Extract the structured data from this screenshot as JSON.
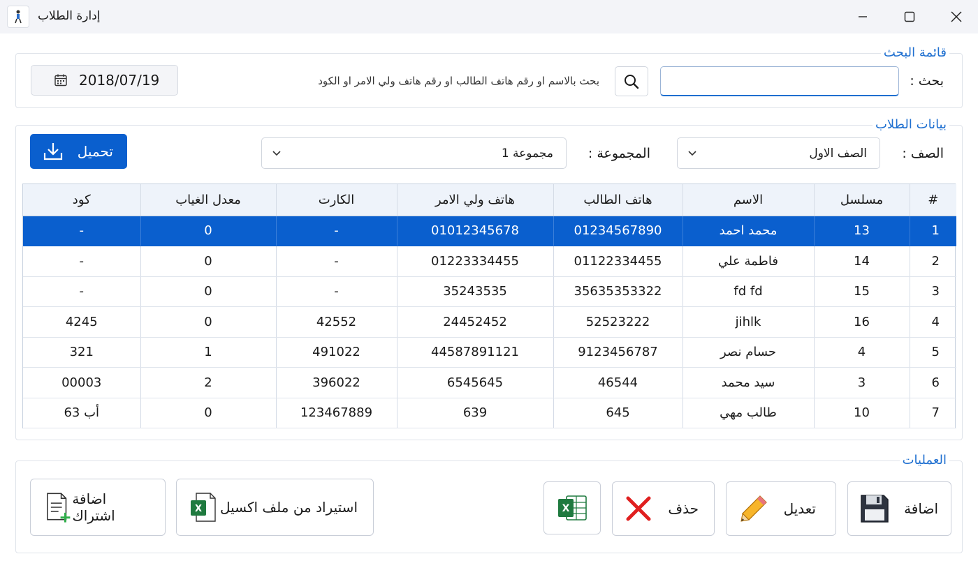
{
  "window": {
    "title": "إدارة الطلاب",
    "controls": [
      "minimize",
      "maximize",
      "close"
    ]
  },
  "search_group": {
    "legend": "قائمة البحث",
    "label": "بحث  :",
    "input_value": "",
    "hint": "بحث بالاسم او رقم هاتف الطالب او رقم هاتف ولي الامر او الكود",
    "date": "2018/07/19"
  },
  "students_group": {
    "legend": "بيانات الطلاب",
    "class_label": "الصف  :",
    "class_value": "الصف الاول",
    "group_label": "المجموعة  :",
    "group_value": "مجموعة 1",
    "download_label": "تحميل"
  },
  "table": {
    "headers": [
      "#",
      "مسلسل",
      "الاسم",
      "هاتف الطالب",
      "هاتف ولي الامر",
      "الكارت",
      "معدل الغياب",
      "كود"
    ],
    "rows": [
      [
        "1",
        "13",
        "محمد احمد",
        "01234567890",
        "01012345678",
        "-",
        "0",
        "-"
      ],
      [
        "2",
        "14",
        "فاطمة علي",
        "01122334455",
        "01223334455",
        "-",
        "0",
        "-"
      ],
      [
        "3",
        "15",
        "fd fd",
        "35635353322",
        "35243535",
        "-",
        "0",
        "-"
      ],
      [
        "4",
        "16",
        "jihlk",
        "52523222",
        "24452452",
        "42552",
        "0",
        "4245"
      ],
      [
        "5",
        "4",
        "حسام نصر",
        "9123456787",
        "44587891121",
        "491022",
        "1",
        "321"
      ],
      [
        "6",
        "3",
        "سيد محمد",
        "46544",
        "6545645",
        "396022",
        "2",
        "00003"
      ],
      [
        "7",
        "10",
        "طالب مهي",
        "645",
        "639",
        "123467889",
        "0",
        "أب 63"
      ]
    ],
    "selected_row": 0
  },
  "operations_group": {
    "legend": "العمليات",
    "add_label": "اضافة",
    "edit_label": "تعديل",
    "delete_label": "حذف",
    "import_label": "استيراد من ملف اكسيل",
    "subscription_label": "اضافة اشتراك"
  },
  "colors": {
    "accent": "#1e6fd0",
    "selection": "#0a5fce",
    "excel_green": "#1f7a3f",
    "delete_red": "#e02020"
  }
}
